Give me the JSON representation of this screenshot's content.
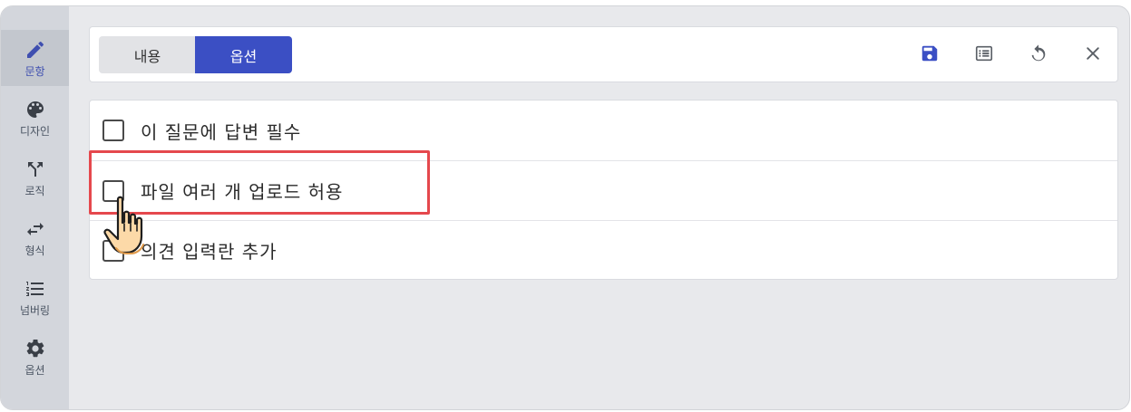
{
  "sidebar": {
    "items": [
      {
        "label": "문항",
        "icon": "pencil-icon",
        "active": true
      },
      {
        "label": "디자인",
        "icon": "palette-icon",
        "active": false
      },
      {
        "label": "로직",
        "icon": "branch-icon",
        "active": false
      },
      {
        "label": "형식",
        "icon": "swap-arrows-icon",
        "active": false
      },
      {
        "label": "넘버링",
        "icon": "numbered-list-icon",
        "active": false
      },
      {
        "label": "옵션",
        "icon": "gear-icon",
        "active": false
      }
    ]
  },
  "toolbar": {
    "tabs": [
      {
        "label": "내용",
        "selected": false
      },
      {
        "label": "옵션",
        "selected": true
      }
    ],
    "actions": [
      "save-icon",
      "list-icon",
      "undo-icon",
      "close-icon"
    ]
  },
  "options": [
    {
      "label": "이 질문에 답변 필수",
      "checked": false
    },
    {
      "label": "파일 여러 개 업로드 허용",
      "checked": false
    },
    {
      "label": "의견 입력란 추가",
      "checked": false
    }
  ],
  "colors": {
    "accent": "#3b4fc4",
    "highlight": "#e5484d",
    "sidebar_bg": "#d3d6dc"
  }
}
